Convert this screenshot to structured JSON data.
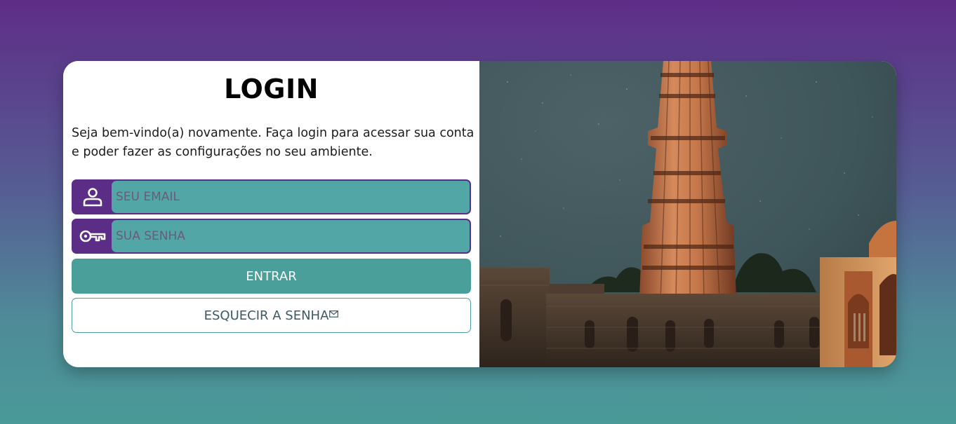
{
  "login": {
    "title": "LOGIN",
    "description": "Seja bem-vindo(a) novamente. Faça login para acessar sua conta e poder fazer as configurações no seu ambiente.",
    "email": {
      "placeholder": "SEU EMAIL",
      "value": "",
      "icon": "user-icon"
    },
    "password": {
      "placeholder": "SUA SENHA",
      "value": "",
      "icon": "key-icon"
    },
    "enter_label": "ENTRAR",
    "forgot_label": "ESQUECIR A SENHA",
    "forgot_icon": "mail-icon"
  },
  "colors": {
    "accent_purple": "#5b2d86",
    "accent_teal": "#4b9f9b",
    "input_fill": "#52a7a6"
  },
  "hero_image": {
    "subject": "tower-night-photo"
  }
}
